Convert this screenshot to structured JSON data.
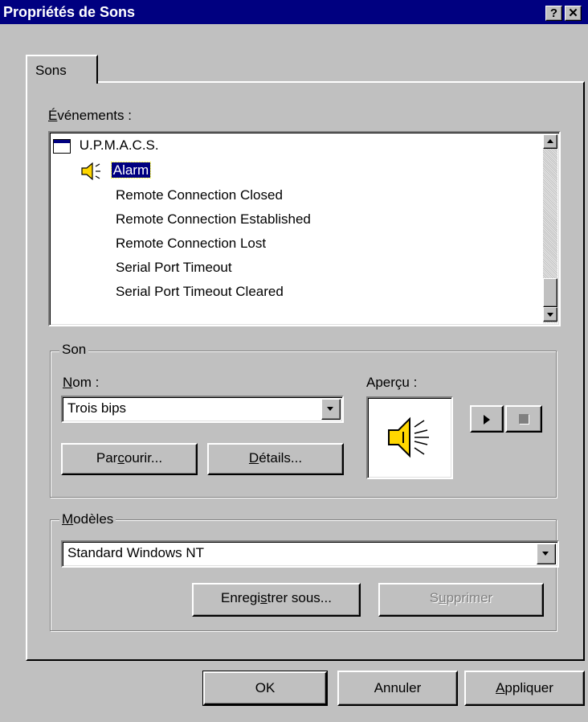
{
  "window": {
    "title": "Propriétés de Sons",
    "help_button": "?",
    "close_button": "✕"
  },
  "tab": {
    "label": "Sons"
  },
  "events": {
    "label_underlined": "É",
    "label_rest": "vénements :",
    "group_item": "U.P.M.A.C.S.",
    "items": [
      {
        "label": "Alarm",
        "has_sound": true,
        "selected": true
      },
      {
        "label": "Remote Connection Closed",
        "has_sound": false,
        "selected": false
      },
      {
        "label": "Remote Connection Established",
        "has_sound": false,
        "selected": false
      },
      {
        "label": "Remote Connection Lost",
        "has_sound": false,
        "selected": false
      },
      {
        "label": "Serial Port Timeout",
        "has_sound": false,
        "selected": false
      },
      {
        "label": "Serial Port Timeout Cleared",
        "has_sound": false,
        "selected": false
      }
    ]
  },
  "sound": {
    "group_title": "Son",
    "name_label_underlined": "N",
    "name_label_rest": "om :",
    "name_value": "Trois bips",
    "preview_label": "Aperçu :",
    "browse_pre": "Par",
    "browse_u": "c",
    "browse_post": "ourir...",
    "details_u": "D",
    "details_post": "étails..."
  },
  "schemes": {
    "group_title_u": "M",
    "group_title_rest": "odèles",
    "value": "Standard Windows NT",
    "save_pre": "Enregi",
    "save_u": "s",
    "save_post": "trer sous...",
    "delete_pre": "S",
    "delete_u": "u",
    "delete_post": "pprimer"
  },
  "footer": {
    "ok": "OK",
    "cancel": "Annuler",
    "apply_u": "A",
    "apply_post": "ppliquer"
  },
  "colors": {
    "titlebar": "#000080",
    "face": "#c0c0c0",
    "selection": "#000080"
  },
  "icons": [
    "help-icon",
    "close-icon",
    "window-icon",
    "speaker-icon",
    "play-icon",
    "stop-icon",
    "scroll-up-icon",
    "scroll-down-icon",
    "dropdown-arrow-icon"
  ]
}
